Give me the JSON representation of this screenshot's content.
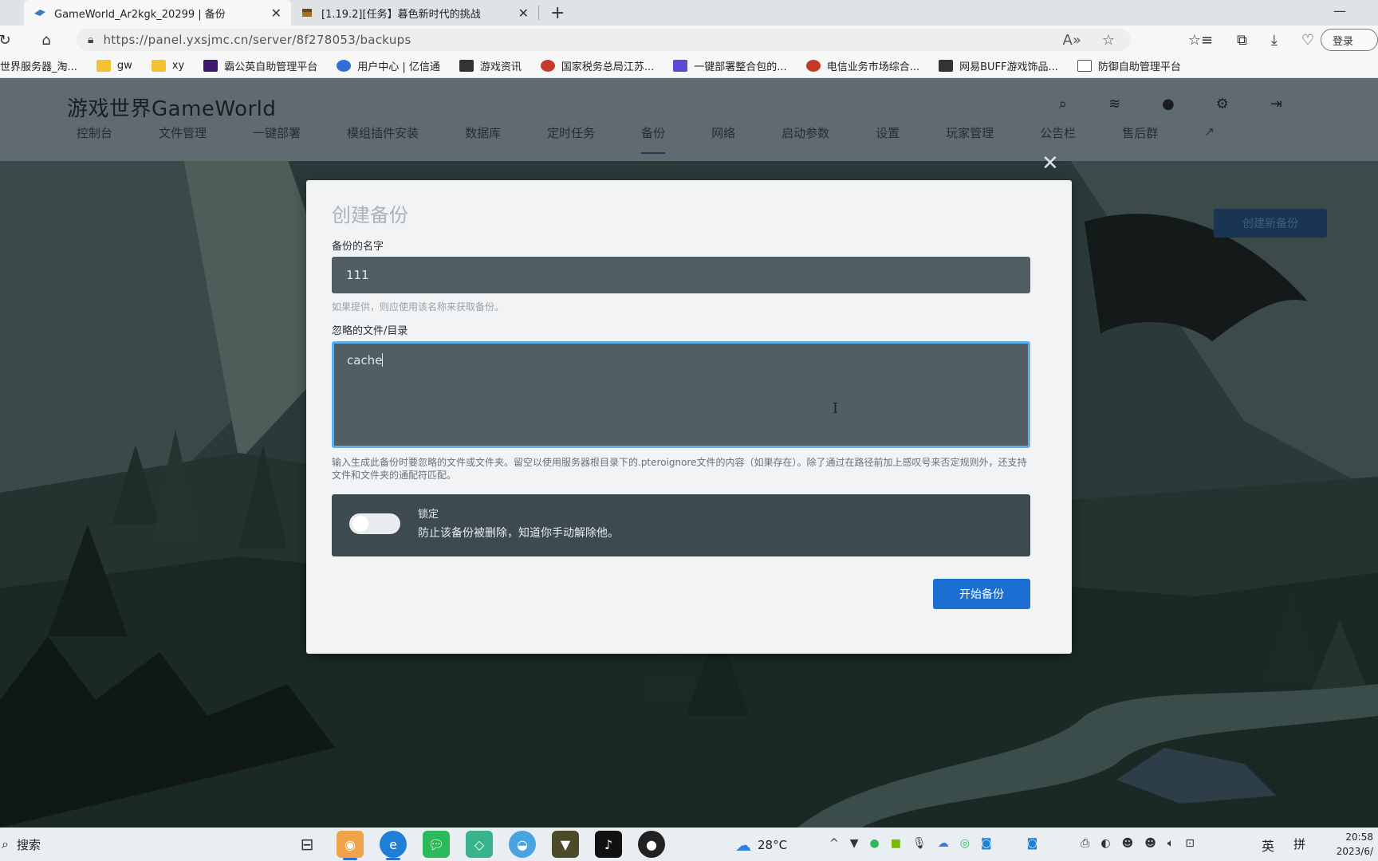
{
  "browser": {
    "tabs": [
      {
        "title": "GameWorld_Ar2kgk_20299 | 备份",
        "close": "✕"
      },
      {
        "title": "[1.19.2][任务】暮色新时代的挑战",
        "close": "✕"
      }
    ],
    "new_tab": "+",
    "minimize": "—",
    "url": "https://panel.yxsjmc.cn/server/8f278053/backups",
    "login_label": "登录",
    "bookmarks": [
      {
        "label": "世界服务器_淘...",
        "icon": "page-icon"
      },
      {
        "label": "gw",
        "icon": "folder-icon"
      },
      {
        "label": "xy",
        "icon": "folder-icon"
      },
      {
        "label": "霸公英自助管理平台",
        "icon": "u-icon"
      },
      {
        "label": "用户中心 | 亿信通",
        "icon": "globe-icon"
      },
      {
        "label": "游戏资讯",
        "icon": "b-icon"
      },
      {
        "label": "国家税务总局江苏...",
        "icon": "emblem-icon"
      },
      {
        "label": "一键部署整合包的...",
        "icon": "grid-icon"
      },
      {
        "label": "电信业务市场综合...",
        "icon": "telecom-icon"
      },
      {
        "label": "网易BUFF游戏饰品...",
        "icon": "b-icon"
      },
      {
        "label": "防御自助管理平台",
        "icon": "page-icon"
      }
    ]
  },
  "site": {
    "title": "游戏世界GameWorld",
    "nav": [
      "控制台",
      "文件管理",
      "一键部署",
      "模组插件安装",
      "数据库",
      "定时任务",
      "备份",
      "网络",
      "启动参数",
      "设置",
      "玩家管理",
      "公告栏",
      "售后群"
    ],
    "create_new_backup": "创建新备份"
  },
  "modal": {
    "close": "✕",
    "title": "创建备份",
    "name_label": "备份的名字",
    "name_value": "111",
    "name_hint": "如果提供，则应使用该名称来获取备份。",
    "ignore_label": "忽略的文件/目录",
    "ignore_value": "cache",
    "ignore_hint": "输入生成此备份时要忽略的文件或文件夹。留空以使用服务器根目录下的.pteroignore文件的内容（如果存在）。除了通过在路径前加上感叹号来否定规则外，还支持文件和文件夹的通配符匹配。",
    "lock_title": "锁定",
    "lock_desc": "防止该备份被删除，知道你手动解除他。",
    "lock_enabled": false,
    "submit": "开始备份"
  },
  "taskbar": {
    "search_placeholder": "搜索",
    "weather": "28°C",
    "ime_lang": "英",
    "ime_mode": "拼",
    "time": "20:58",
    "date": "2023/6/"
  },
  "colors": {
    "accent": "#1b6fd3",
    "header": "#5f6b70",
    "input_bg": "#515e64"
  }
}
